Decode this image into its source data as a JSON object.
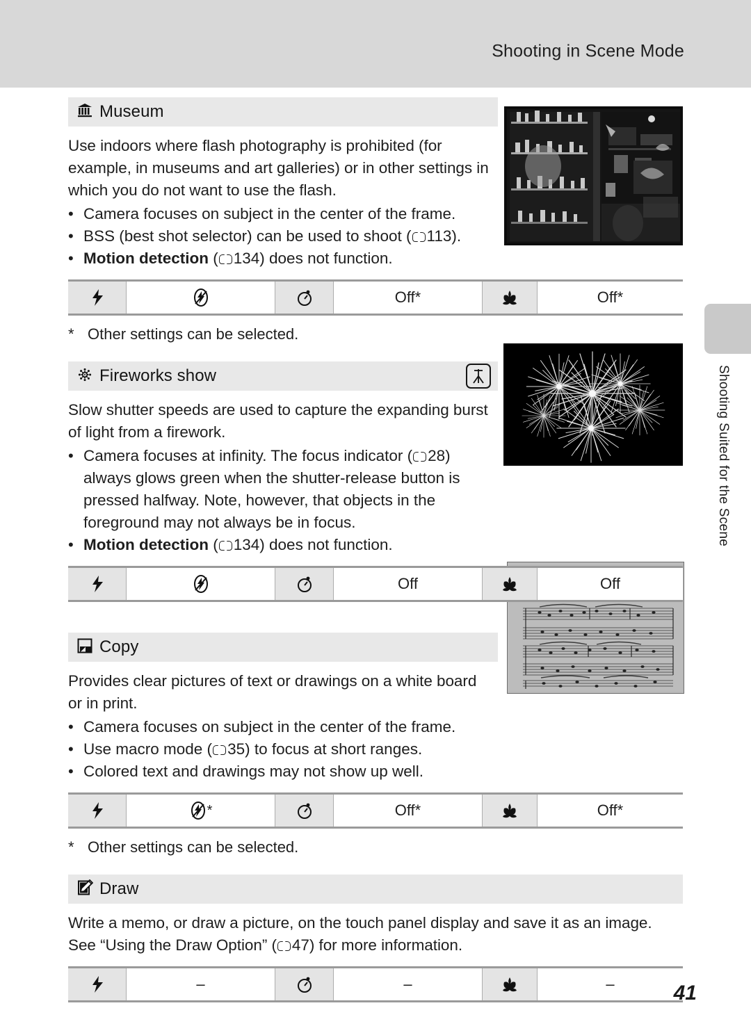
{
  "header": {
    "title": "Shooting in Scene Mode"
  },
  "side_tab": {
    "label": "Shooting Suited for the Scene"
  },
  "page_number": "41",
  "footnote": {
    "mark": "*",
    "text": "Other settings can be selected."
  },
  "sections": [
    {
      "id": "museum",
      "icon": "museum-icon",
      "title": "Museum",
      "paragraph": "Use indoors where flash photography is prohibited (for example, in museums and art galleries) or in other settings in which you do not want to use the flash.",
      "bullets": [
        {
          "pre": "Camera focuses on subject in the center of the frame.",
          "bold": "",
          "ref": "",
          "post": ""
        },
        {
          "pre": "BSS (best shot selector) can be used to shoot (",
          "bold": "",
          "ref": "113",
          "post": ")."
        },
        {
          "pre": "",
          "bold": "Motion detection",
          "ref": "134",
          "post": " does not function."
        }
      ],
      "badge": "",
      "settings": {
        "flash_icon": "flash-icon",
        "flash_value": "flash-off-icon",
        "flash_value_star": "",
        "timer_icon": "self-timer-icon",
        "timer_value": "Off*",
        "macro_icon": "macro-icon",
        "macro_value": "Off*"
      },
      "has_footnote": true,
      "photo": "museum-interior-photo"
    },
    {
      "id": "fireworks",
      "icon": "fireworks-icon",
      "title": "Fireworks show",
      "paragraph": "Slow shutter speeds are used to capture the expanding burst of light from a firework.",
      "bullets": [
        {
          "pre": "Camera focuses at infinity. The focus indicator (",
          "bold": "",
          "ref": "28",
          "post": ") always glows green when the shutter-release button is pressed halfway. Note, however, that objects in the foreground may not always be in focus."
        },
        {
          "pre": "",
          "bold": "Motion detection",
          "ref": "134",
          "post": " does not function."
        }
      ],
      "badge": "tripod-icon",
      "settings": {
        "flash_icon": "flash-icon",
        "flash_value": "flash-off-icon",
        "flash_value_star": "",
        "timer_icon": "self-timer-icon",
        "timer_value": "Off",
        "macro_icon": "macro-icon",
        "macro_value": "Off"
      },
      "has_footnote": false,
      "photo": "fireworks-photo"
    },
    {
      "id": "copy",
      "icon": "copy-icon",
      "title": "Copy",
      "paragraph": "Provides clear pictures of text or drawings on a white board or in print.",
      "bullets": [
        {
          "pre": "Camera focuses on subject in the center of the frame.",
          "bold": "",
          "ref": "",
          "post": ""
        },
        {
          "pre": "Use macro mode (",
          "bold": "",
          "ref": "35",
          "post": ") to focus at short ranges."
        },
        {
          "pre": "Colored text and drawings may not show up well.",
          "bold": "",
          "ref": "",
          "post": ""
        }
      ],
      "badge": "",
      "settings": {
        "flash_icon": "flash-icon",
        "flash_value": "flash-off-icon",
        "flash_value_star": "*",
        "timer_icon": "self-timer-icon",
        "timer_value": "Off*",
        "macro_icon": "macro-icon",
        "macro_value": "Off*"
      },
      "has_footnote": true,
      "photo": "sheet-music-photo"
    },
    {
      "id": "draw",
      "icon": "draw-icon",
      "title": "Draw",
      "paragraph": "Write a memo, or draw a picture, on the touch panel display and save it as an image.",
      "paragraph2_pre": "See “Using the Draw Option” (",
      "paragraph2_ref": "47",
      "paragraph2_post": ") for more information.",
      "bullets": [],
      "badge": "",
      "settings": {
        "flash_icon": "flash-icon",
        "flash_value": "–",
        "flash_value_star": "",
        "timer_icon": "self-timer-icon",
        "timer_value": "–",
        "macro_icon": "macro-icon",
        "macro_value": "–"
      },
      "has_footnote": false,
      "photo": ""
    }
  ]
}
